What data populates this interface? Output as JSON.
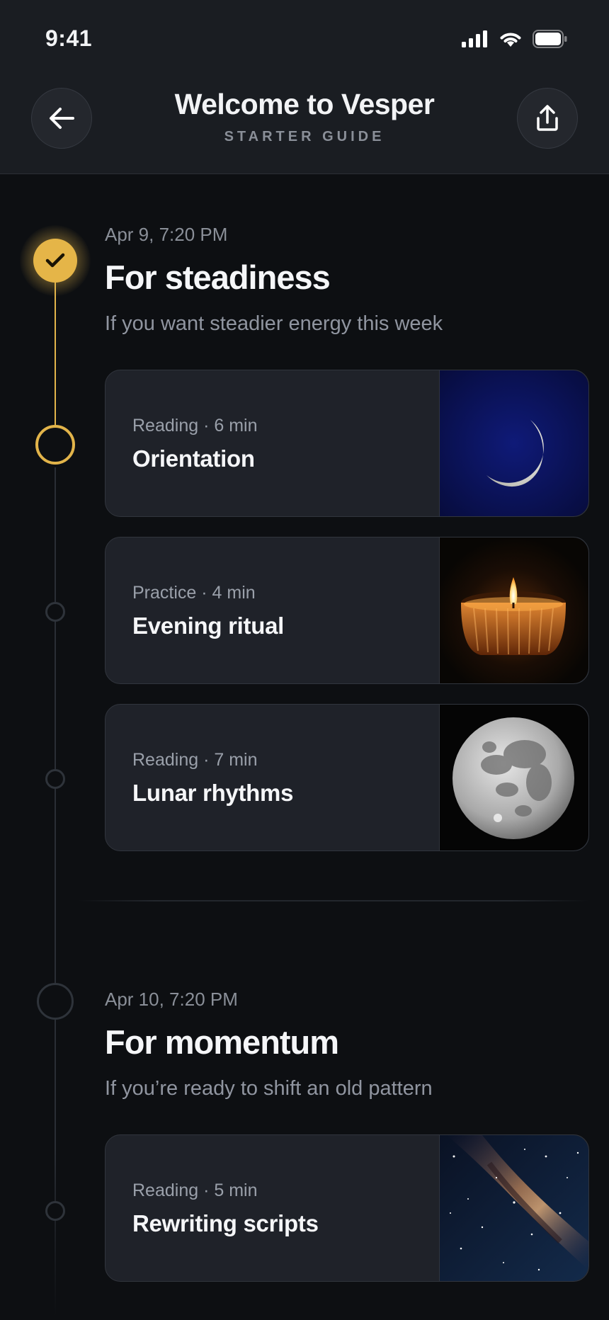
{
  "status_bar": {
    "time": "9:41"
  },
  "header": {
    "title": "Welcome to Vesper",
    "subtitle": "STARTER GUIDE"
  },
  "sections": [
    {
      "date": "Apr 9, 7:20 PM",
      "title": "For steadiness",
      "description": "If you want steadier energy this week",
      "status": "completed",
      "items": [
        {
          "meta": "Reading · 6 min",
          "title": "Orientation",
          "thumbnail": "crescent-moon"
        },
        {
          "meta": "Practice · 4 min",
          "title": "Evening ritual",
          "thumbnail": "candle"
        },
        {
          "meta": "Reading · 7 min",
          "title": "Lunar rhythms",
          "thumbnail": "full-moon"
        }
      ]
    },
    {
      "date": "Apr 10, 7:20 PM",
      "title": "For momentum",
      "description": "If you’re ready to shift an old pattern",
      "status": "upcoming",
      "items": [
        {
          "meta": "Reading · 5 min",
          "title": "Rewriting scripts",
          "thumbnail": "milky-way"
        }
      ]
    }
  ],
  "colors": {
    "accent": "#e5b548",
    "background": "#0d0f12",
    "card": "#1f2229",
    "header": "#1a1d22"
  }
}
